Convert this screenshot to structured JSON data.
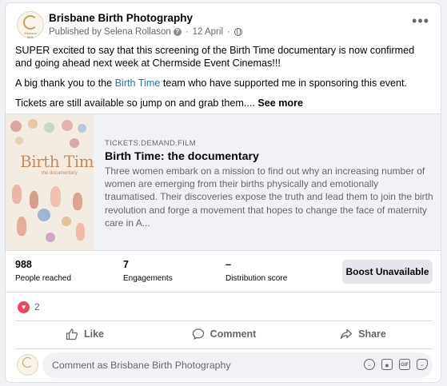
{
  "post": {
    "page_name": "Brisbane Birth Photography",
    "published_by": "Published by Selena Rollason",
    "info_icon": "question-icon",
    "date": "12 April",
    "privacy_icon": "globe-icon",
    "more_icon": "more-horizontal-icon",
    "more_label": "•••",
    "avatar_text": "Brisbane Birth",
    "paragraphs": {
      "p1": "SUPER excited to say that this screening of the Birth Time documentary is now confirmed and going ahead next week at Chermside Event Cinemas!!!",
      "p2_before": "A  big thank you to the ",
      "p2_link": "Birth Time",
      "p2_after": " team who have supported me in sponsoring this event.",
      "p3": "Tickets are still available so jump on and grab them....",
      "see_more": "See more"
    }
  },
  "link_preview": {
    "domain": "TICKETS.DEMAND.FILM",
    "title": "Birth Time: the documentary",
    "description": "Three women embark on a mission to find out why an increasing number of women are emerging from their births physically and emotionally traumatised. Their discoveries expose the truth and lead them to join the birth revolution and forge a movement that hopes to change the face of maternity care in A...",
    "poster_title": "Birth Time",
    "poster_subtitle": "the documentary"
  },
  "insights": {
    "people_reached_value": "988",
    "people_reached_label": "People reached",
    "engagements_value": "7",
    "engagements_label": "Engagements",
    "distribution_value": "–",
    "distribution_label": "Distribution score",
    "boost_label": "Boost Unavailable"
  },
  "reactions": {
    "icon": "love-heart-icon",
    "count": "2"
  },
  "actions": {
    "like": "Like",
    "comment": "Comment",
    "share": "Share"
  },
  "comment_box": {
    "placeholder": "Comment as Brisbane Birth Photography",
    "icons": [
      "emoji-icon",
      "camera-icon",
      "gif-icon",
      "sticker-icon"
    ],
    "gif_label": "GIF"
  },
  "colors": {
    "link": "#216fdb",
    "love": "#f3425f",
    "secondary_text": "#65676b",
    "preview_bg": "#f0f2f5"
  }
}
